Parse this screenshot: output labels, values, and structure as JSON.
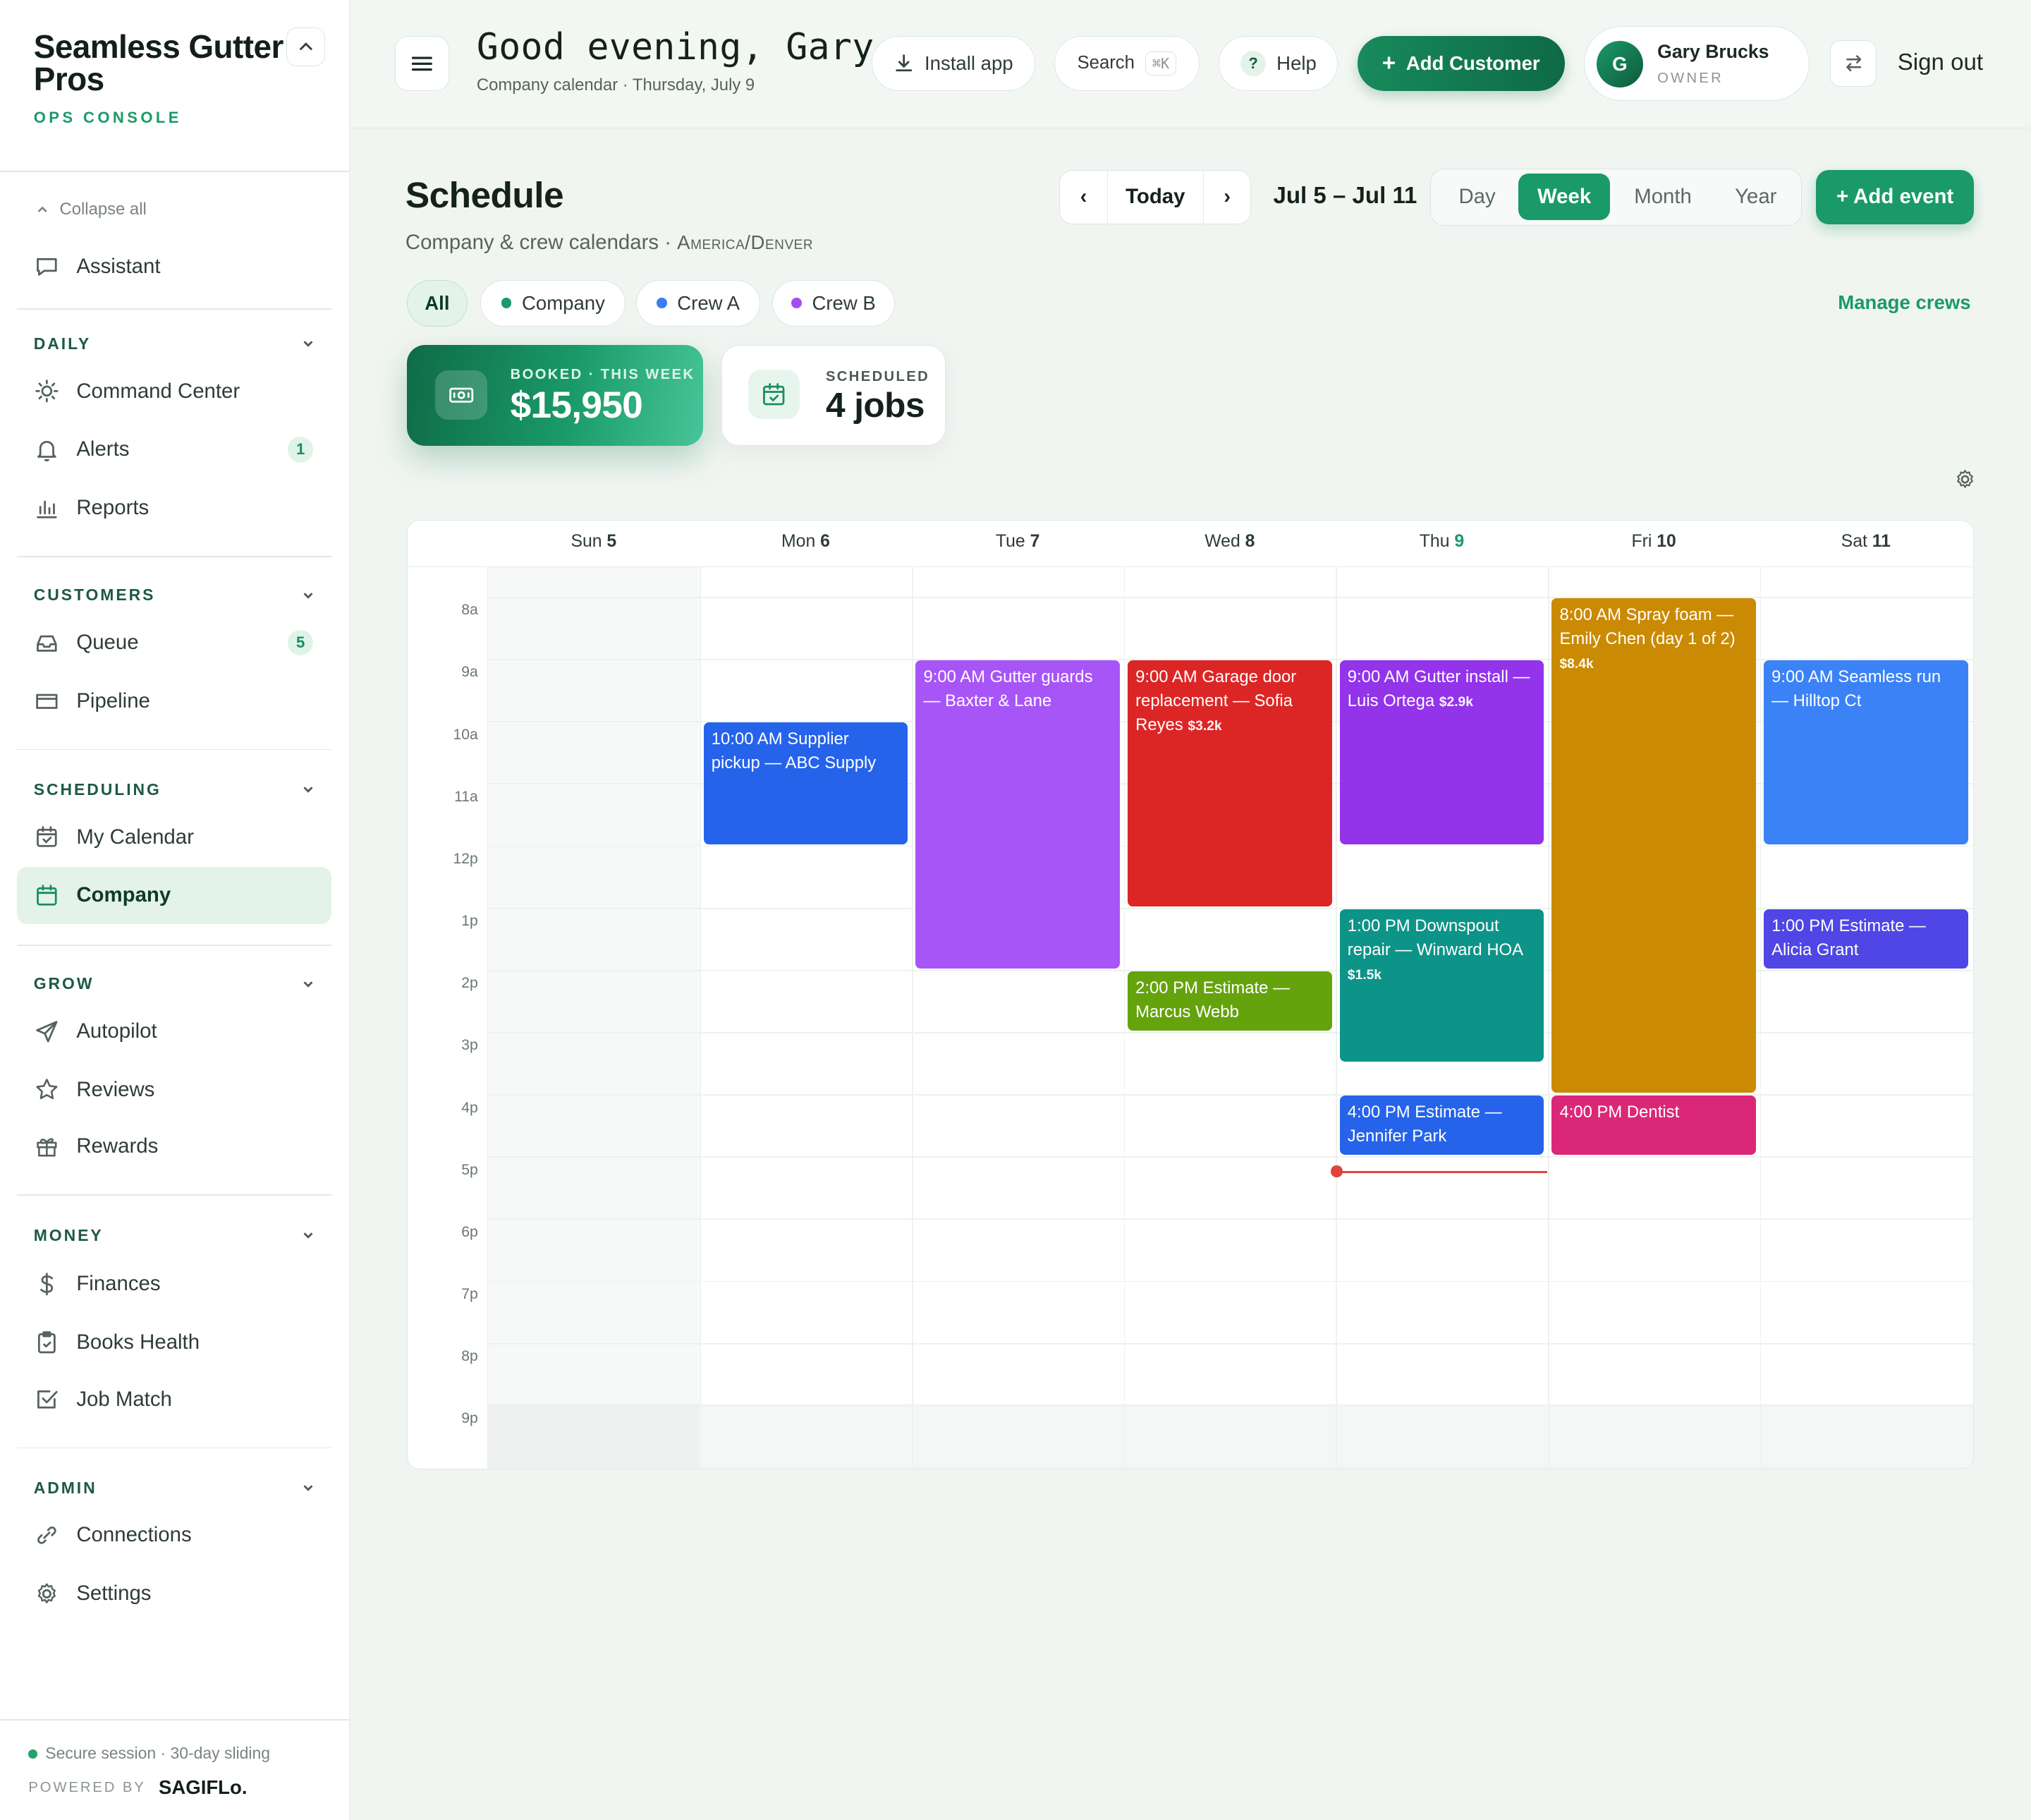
{
  "brand": {
    "name": "Seamless Gutter Pros",
    "subtitle": "OPS CONSOLE"
  },
  "sidebar": {
    "collapse_all": "Collapse all",
    "assistant": "Assistant",
    "sections": {
      "daily": {
        "title": "DAILY",
        "items": [
          {
            "label": "Command Center",
            "icon": "sun-icon"
          },
          {
            "label": "Alerts",
            "icon": "bell-icon",
            "badge": "1"
          },
          {
            "label": "Reports",
            "icon": "bar-chart-icon"
          }
        ]
      },
      "customers": {
        "title": "CUSTOMERS",
        "items": [
          {
            "label": "Queue",
            "icon": "inbox-icon",
            "badge": "5"
          },
          {
            "label": "Pipeline",
            "icon": "folder-icon"
          }
        ]
      },
      "scheduling": {
        "title": "SCHEDULING",
        "items": [
          {
            "label": "My Calendar",
            "icon": "calendar-check-icon"
          },
          {
            "label": "Company",
            "icon": "calendar-icon",
            "active": true
          }
        ]
      },
      "grow": {
        "title": "GROW",
        "items": [
          {
            "label": "Autopilot",
            "icon": "send-icon"
          },
          {
            "label": "Reviews",
            "icon": "star-icon"
          },
          {
            "label": "Rewards",
            "icon": "gift-icon"
          }
        ]
      },
      "money": {
        "title": "MONEY",
        "items": [
          {
            "label": "Finances",
            "icon": "dollar-icon"
          },
          {
            "label": "Books Health",
            "icon": "clipboard-check-icon"
          },
          {
            "label": "Job Match",
            "icon": "checkbox-icon"
          }
        ]
      },
      "admin": {
        "title": "ADMIN",
        "items": [
          {
            "label": "Connections",
            "icon": "link-icon"
          },
          {
            "label": "Settings",
            "icon": "gear-icon"
          }
        ]
      }
    },
    "footer": {
      "session": "Secure session · 30-day sliding",
      "powered_by": "POWERED BY",
      "powered_brand": "SAGIFLo."
    }
  },
  "header": {
    "greeting": "Good evening, Gary",
    "subtitle": "Company calendar · Thursday, July 9",
    "install_app": "Install app",
    "search": "Search",
    "search_shortcut": "⌘K",
    "help": "Help",
    "add_customer": "Add Customer",
    "user": {
      "initial": "G",
      "name": "Gary Brucks",
      "role": "OWNER"
    },
    "sign_out": "Sign out"
  },
  "schedule": {
    "title": "Schedule",
    "subtitle": "Company & crew calendars · ",
    "timezone": "America/Denver",
    "today": "Today",
    "prev": "‹",
    "next": "›",
    "date_range": "Jul 5 – Jul 11",
    "views": [
      "Day",
      "Week",
      "Month",
      "Year"
    ],
    "active_view": "Week",
    "add_event": "+ Add event",
    "filters": [
      {
        "label": "All",
        "active": true
      },
      {
        "label": "Company",
        "color": "#1a9a68"
      },
      {
        "label": "Crew A",
        "color": "#3b7cf0"
      },
      {
        "label": "Crew B",
        "color": "#a64df2"
      }
    ],
    "manage_crews": "Manage crews",
    "stats": {
      "booked": {
        "label": "BOOKED · THIS WEEK",
        "value": "$15,950"
      },
      "scheduled": {
        "label": "SCHEDULED",
        "value": "4 jobs"
      }
    }
  },
  "calendar": {
    "days": [
      {
        "name": "Sun",
        "num": "5"
      },
      {
        "name": "Mon",
        "num": "6"
      },
      {
        "name": "Tue",
        "num": "7"
      },
      {
        "name": "Wed",
        "num": "8"
      },
      {
        "name": "Thu",
        "num": "9",
        "today": true
      },
      {
        "name": "Fri",
        "num": "10"
      },
      {
        "name": "Sat",
        "num": "11"
      }
    ],
    "hours": [
      "8a",
      "9a",
      "10a",
      "11a",
      "12p",
      "1p",
      "2p",
      "3p",
      "4p",
      "5p",
      "6p",
      "7p",
      "8p",
      "9p"
    ],
    "now_hour": 17.25,
    "events": [
      {
        "day": 1,
        "start": 10,
        "end": 12,
        "text": "10:00 AM Supplier pickup — ABC Supply",
        "color": "#2563eb"
      },
      {
        "day": 2,
        "start": 9,
        "end": 14,
        "text": "9:00 AM Gutter guards — Baxter & Lane",
        "color": "#a855f7"
      },
      {
        "day": 3,
        "start": 9,
        "end": 13,
        "text": "9:00 AM Garage door replacement — Sofia Reyes",
        "amount": "$3.2k",
        "color": "#dc2626"
      },
      {
        "day": 3,
        "start": 14,
        "end": 15,
        "text": "2:00 PM Estimate — Marcus Webb",
        "color": "#65a30d"
      },
      {
        "day": 4,
        "start": 9,
        "end": 12,
        "text": "9:00 AM Gutter install — Luis Ortega",
        "amount": "$2.9k",
        "color": "#9333ea"
      },
      {
        "day": 4,
        "start": 13,
        "end": 15.5,
        "text": "1:00 PM Downspout repair — Winward HOA",
        "amount": "$1.5k",
        "color": "#0d9488"
      },
      {
        "day": 4,
        "start": 16,
        "end": 17,
        "text": "4:00 PM Estimate — Jennifer Park",
        "color": "#2563eb"
      },
      {
        "day": 5,
        "start": 8,
        "end": 16,
        "text": "8:00 AM Spray foam — Emily Chen (day 1 of 2)",
        "amount": "$8.4k",
        "color": "#ca8a04"
      },
      {
        "day": 5,
        "start": 16,
        "end": 17,
        "text": "4:00 PM Dentist",
        "color": "#db2777"
      },
      {
        "day": 6,
        "start": 9,
        "end": 12,
        "text": "9:00 AM Seamless run — Hilltop Ct",
        "color": "#3b82f6"
      },
      {
        "day": 6,
        "start": 13,
        "end": 14,
        "text": "1:00 PM Estimate — Alicia Grant",
        "color": "#4f46e5"
      }
    ]
  }
}
